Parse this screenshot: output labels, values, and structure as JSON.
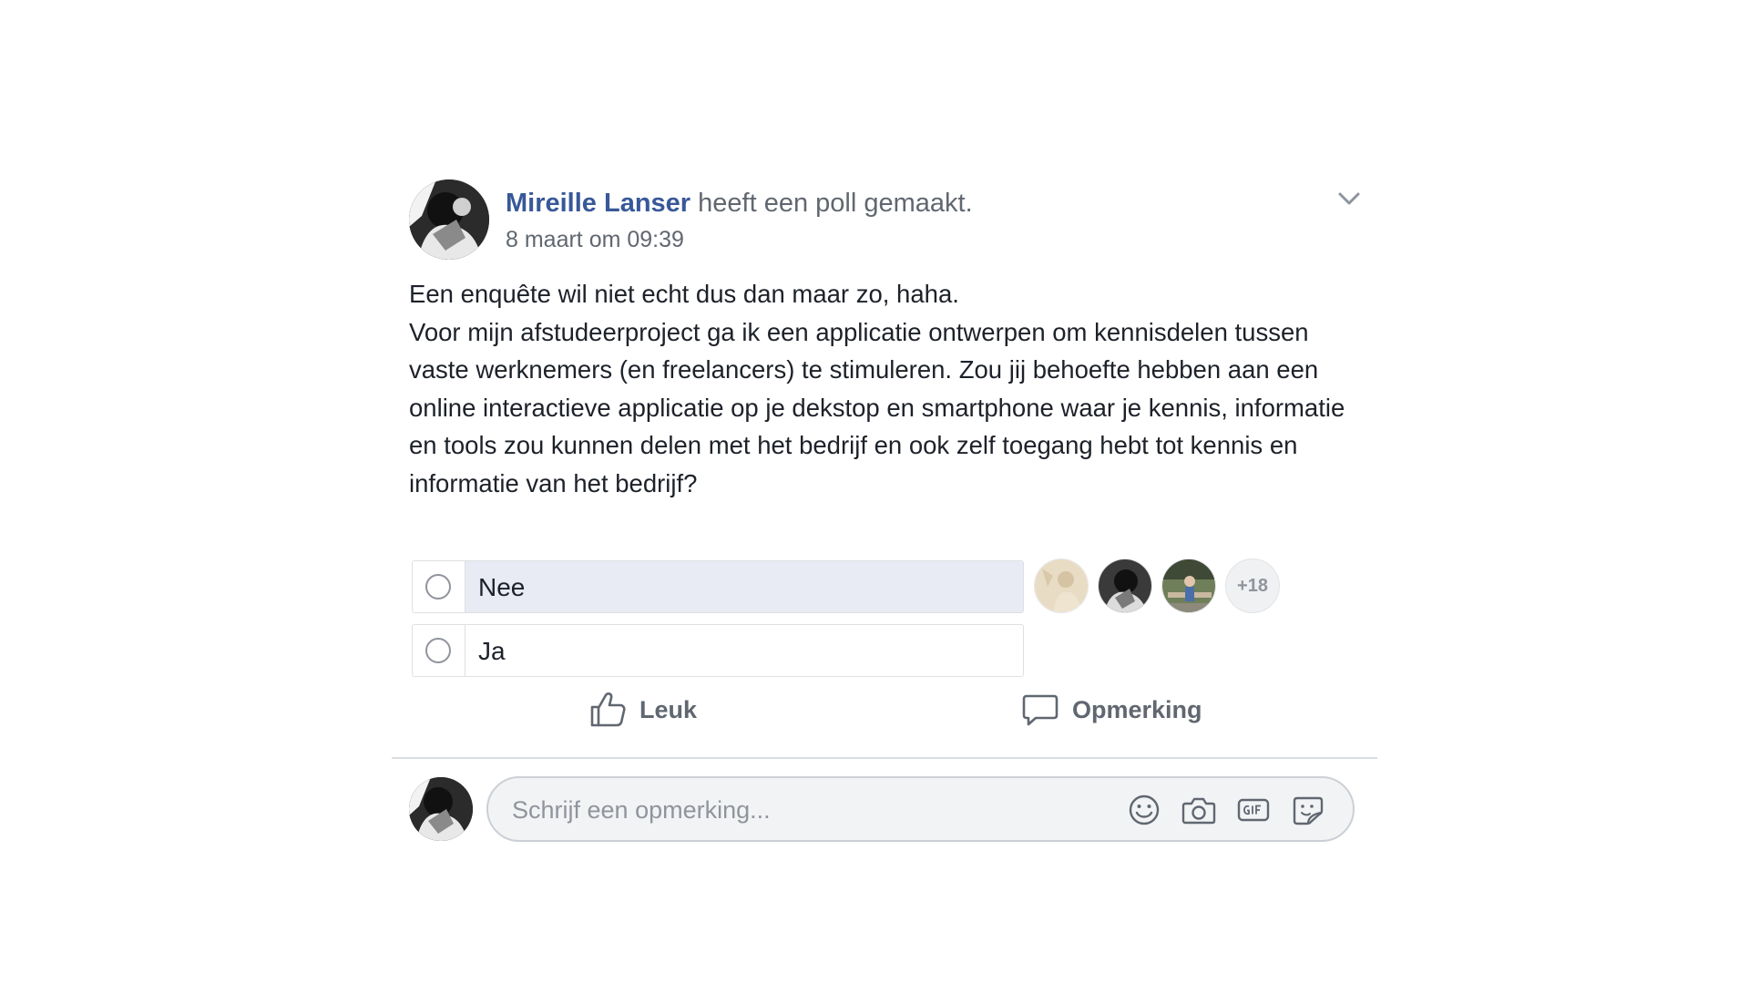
{
  "post": {
    "author": "Mireille Lanser",
    "action_text": " heeft een poll gemaakt.",
    "timestamp": "8 maart om 09:39",
    "body": [
      "Een enquête wil niet echt dus dan maar zo, haha.",
      "Voor mijn afstudeerproject ga ik een applicatie ontwerpen om kennisdelen tussen vaste werknemers (en freelancers) te stimuleren. Zou jij behoefte hebben aan een online interactieve applicatie op je dekstop en smartphone waar je kennis, informatie en tools zou kunnen delen met het bedrijf en ook zelf toegang hebt tot kennis en informatie van het bedrijf?"
    ]
  },
  "poll": {
    "options": [
      {
        "label": "Nee",
        "selected": false
      },
      {
        "label": "Ja",
        "selected": false
      }
    ],
    "more_voters": "+18"
  },
  "actions": {
    "like_label": "Leuk",
    "comment_label": "Opmerking"
  },
  "composer": {
    "placeholder": "Schrijf een opmerking...",
    "tools": [
      "emoji-icon",
      "camera-icon",
      "gif-icon",
      "sticker-icon"
    ]
  },
  "colors": {
    "link": "#385898",
    "muted": "#616770",
    "poll_highlight": "#e9ebf4",
    "border": "#dddfe2"
  }
}
